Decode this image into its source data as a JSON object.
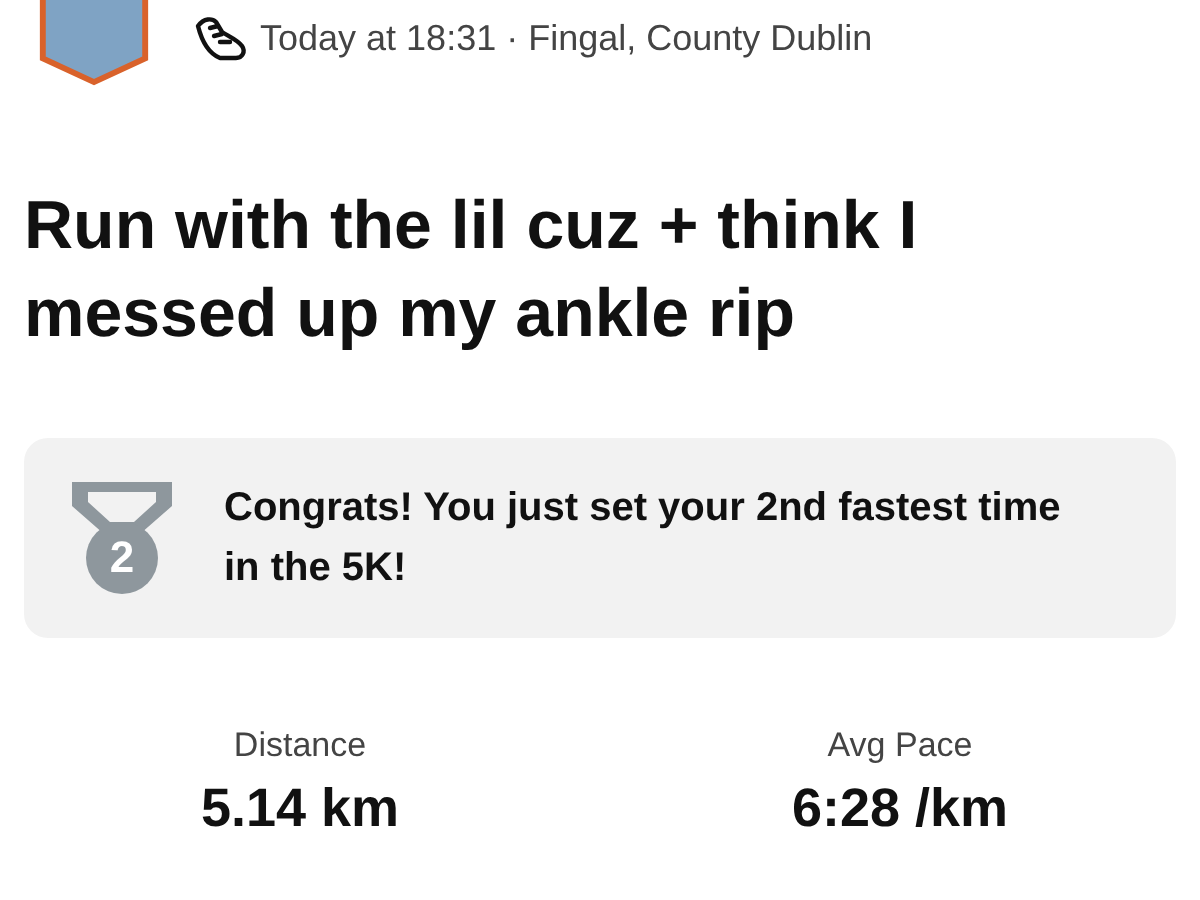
{
  "header": {
    "meta": "Today at 18:31 · Fingal, County Dublin"
  },
  "title": "Run with the lil cuz + think I messed up my ankle rip",
  "achievement": {
    "rank": "2",
    "text": "Congrats! You just set your 2nd fastest time in the 5K!"
  },
  "stats": [
    {
      "label": "Distance",
      "value": "5.14 km"
    },
    {
      "label": "Avg Pace",
      "value": "6:28 /km"
    }
  ]
}
